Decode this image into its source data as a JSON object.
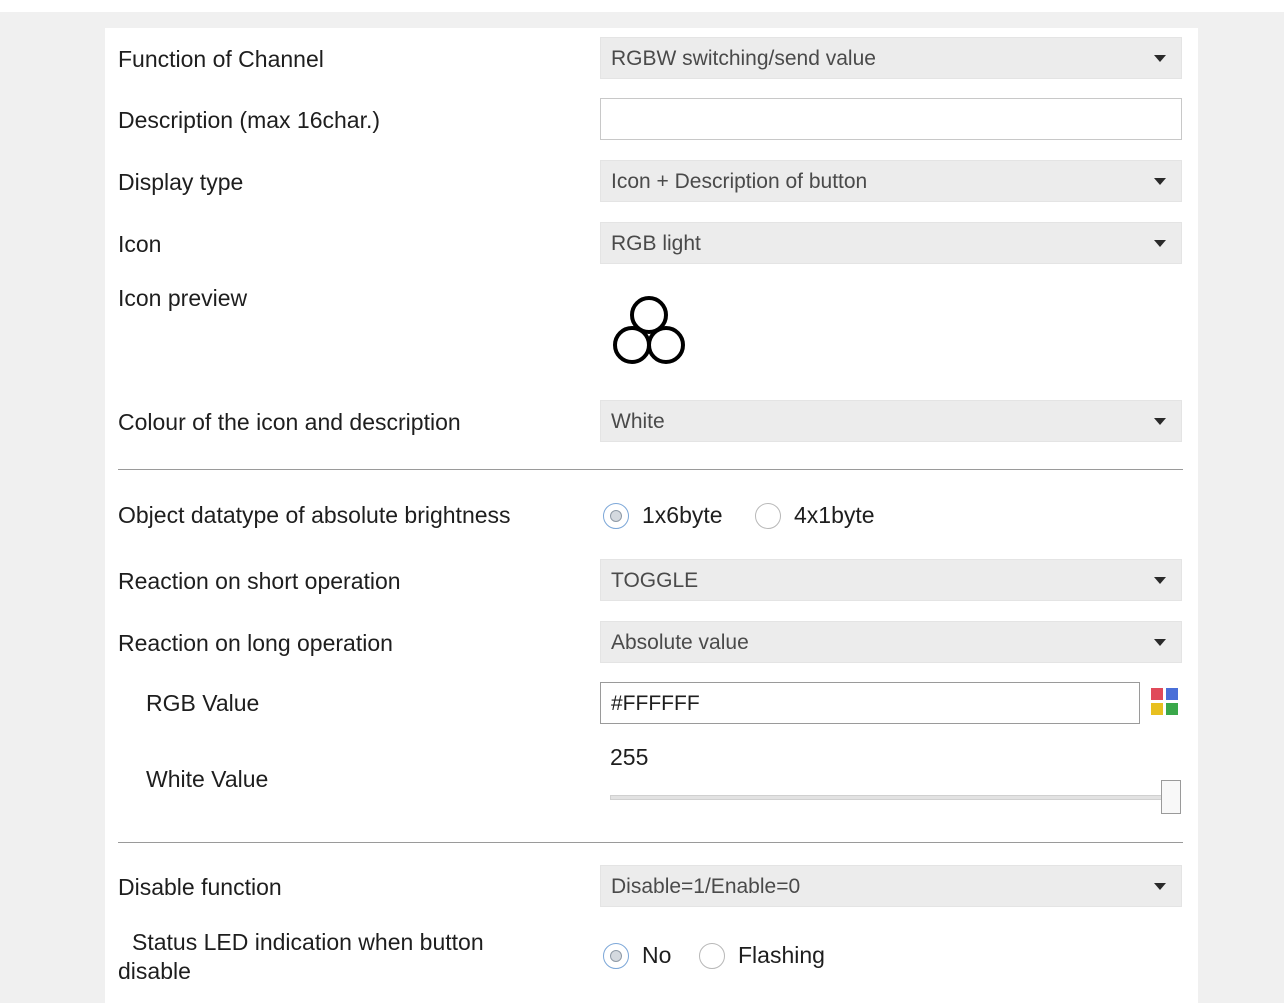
{
  "fields": {
    "function_of_channel": {
      "label": "Function of Channel",
      "value": "RGBW switching/send value"
    },
    "description": {
      "label": "Description (max 16char.)",
      "value": ""
    },
    "display_type": {
      "label": "Display type",
      "value": "Icon + Description of button"
    },
    "icon": {
      "label": "Icon",
      "value": "RGB light"
    },
    "icon_preview": {
      "label": "Icon preview",
      "icon": "rgb-light-icon"
    },
    "colour": {
      "label": "Colour of the icon and description",
      "value": "White"
    },
    "object_datatype": {
      "label": "Object datatype of absolute brightness",
      "options": [
        "1x6byte",
        "4x1byte"
      ],
      "selected": "1x6byte"
    },
    "short_operation": {
      "label": "Reaction on short operation",
      "value": "TOGGLE"
    },
    "long_operation": {
      "label": "Reaction on long operation",
      "value": "Absolute value"
    },
    "rgb_value": {
      "label": "RGB Value",
      "value": "#FFFFFF",
      "picker_icon": "color-palette-icon"
    },
    "white_value": {
      "label": "White Value",
      "value": "255",
      "level": 1.0
    },
    "disable_function": {
      "label": "Disable function",
      "value": "Disable=1/Enable=0"
    },
    "status_led": {
      "label_line1": "Status LED indication when button",
      "label_line2": "disable",
      "options": [
        "No",
        "Flashing"
      ],
      "selected": "No"
    }
  },
  "colors": {
    "panel_bg": "#ffffff",
    "page_bg": "#f0f0f0",
    "dropdown_bg": "#ececec",
    "palette": [
      "#e04a5a",
      "#4a6fd8",
      "#e8c020",
      "#3aa84a"
    ]
  }
}
